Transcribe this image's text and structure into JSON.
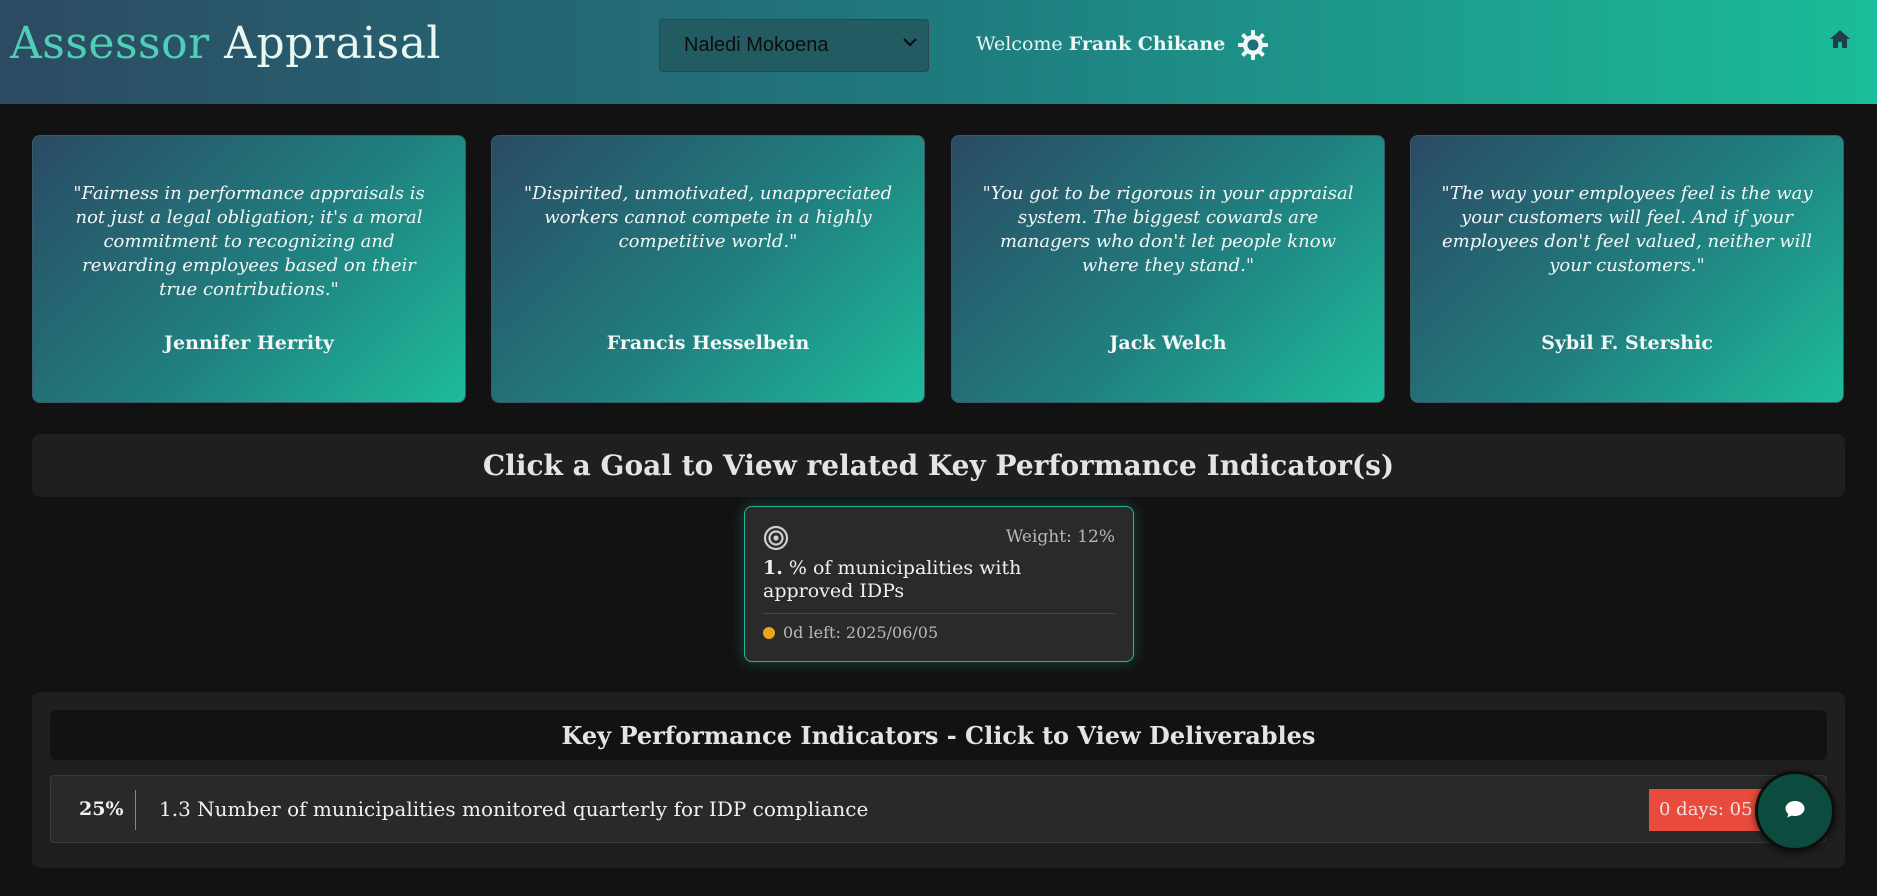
{
  "header": {
    "title_part1": "Assessor",
    "title_part2": "Appraisal",
    "selected_user": "Naledi Mokoena",
    "welcome_label": "Welcome",
    "welcome_name": "Frank Chikane"
  },
  "quotes": [
    {
      "text": "\"Fairness in performance appraisals is not just a legal obligation; it's a moral commitment to recognizing and rewarding employees based on their true contributions.\"",
      "author": "Jennifer Herrity"
    },
    {
      "text": "\"Dispirited, unmotivated, unappreciated workers cannot compete in a highly competitive world.\"",
      "author": "Francis Hesselbein"
    },
    {
      "text": "\"You got to be rigorous in your appraisal system. The biggest cowards are managers who don't let people know where they stand.\"",
      "author": "Jack Welch"
    },
    {
      "text": "\"The way your employees feel is the way your customers will feel. And if your employees don't feel valued, neither will your customers.\"",
      "author": "Sybil F. Stershic"
    }
  ],
  "goals_heading": "Click a Goal to View related Key Performance Indicator(s)",
  "goal": {
    "weight": "Weight: 12%",
    "number": "1.",
    "title": "% of municipalities with approved IDPs",
    "deadline": "0d left: 2025/06/05"
  },
  "kpi": {
    "heading": "Key Performance Indicators - Click to View Deliverables",
    "rows": [
      {
        "percent": "25%",
        "title": "1.3 Number of municipalities monitored quarterly for IDP compliance",
        "badge": "0 days: 05 Jun 2025"
      }
    ]
  },
  "colors": {
    "accent": "#1dbc9b",
    "danger": "#e84b3c",
    "warning": "#f0a31c"
  },
  "icons": [
    "gear-icon",
    "home-icon",
    "target-icon",
    "chat-icon",
    "chevron-down-icon"
  ]
}
